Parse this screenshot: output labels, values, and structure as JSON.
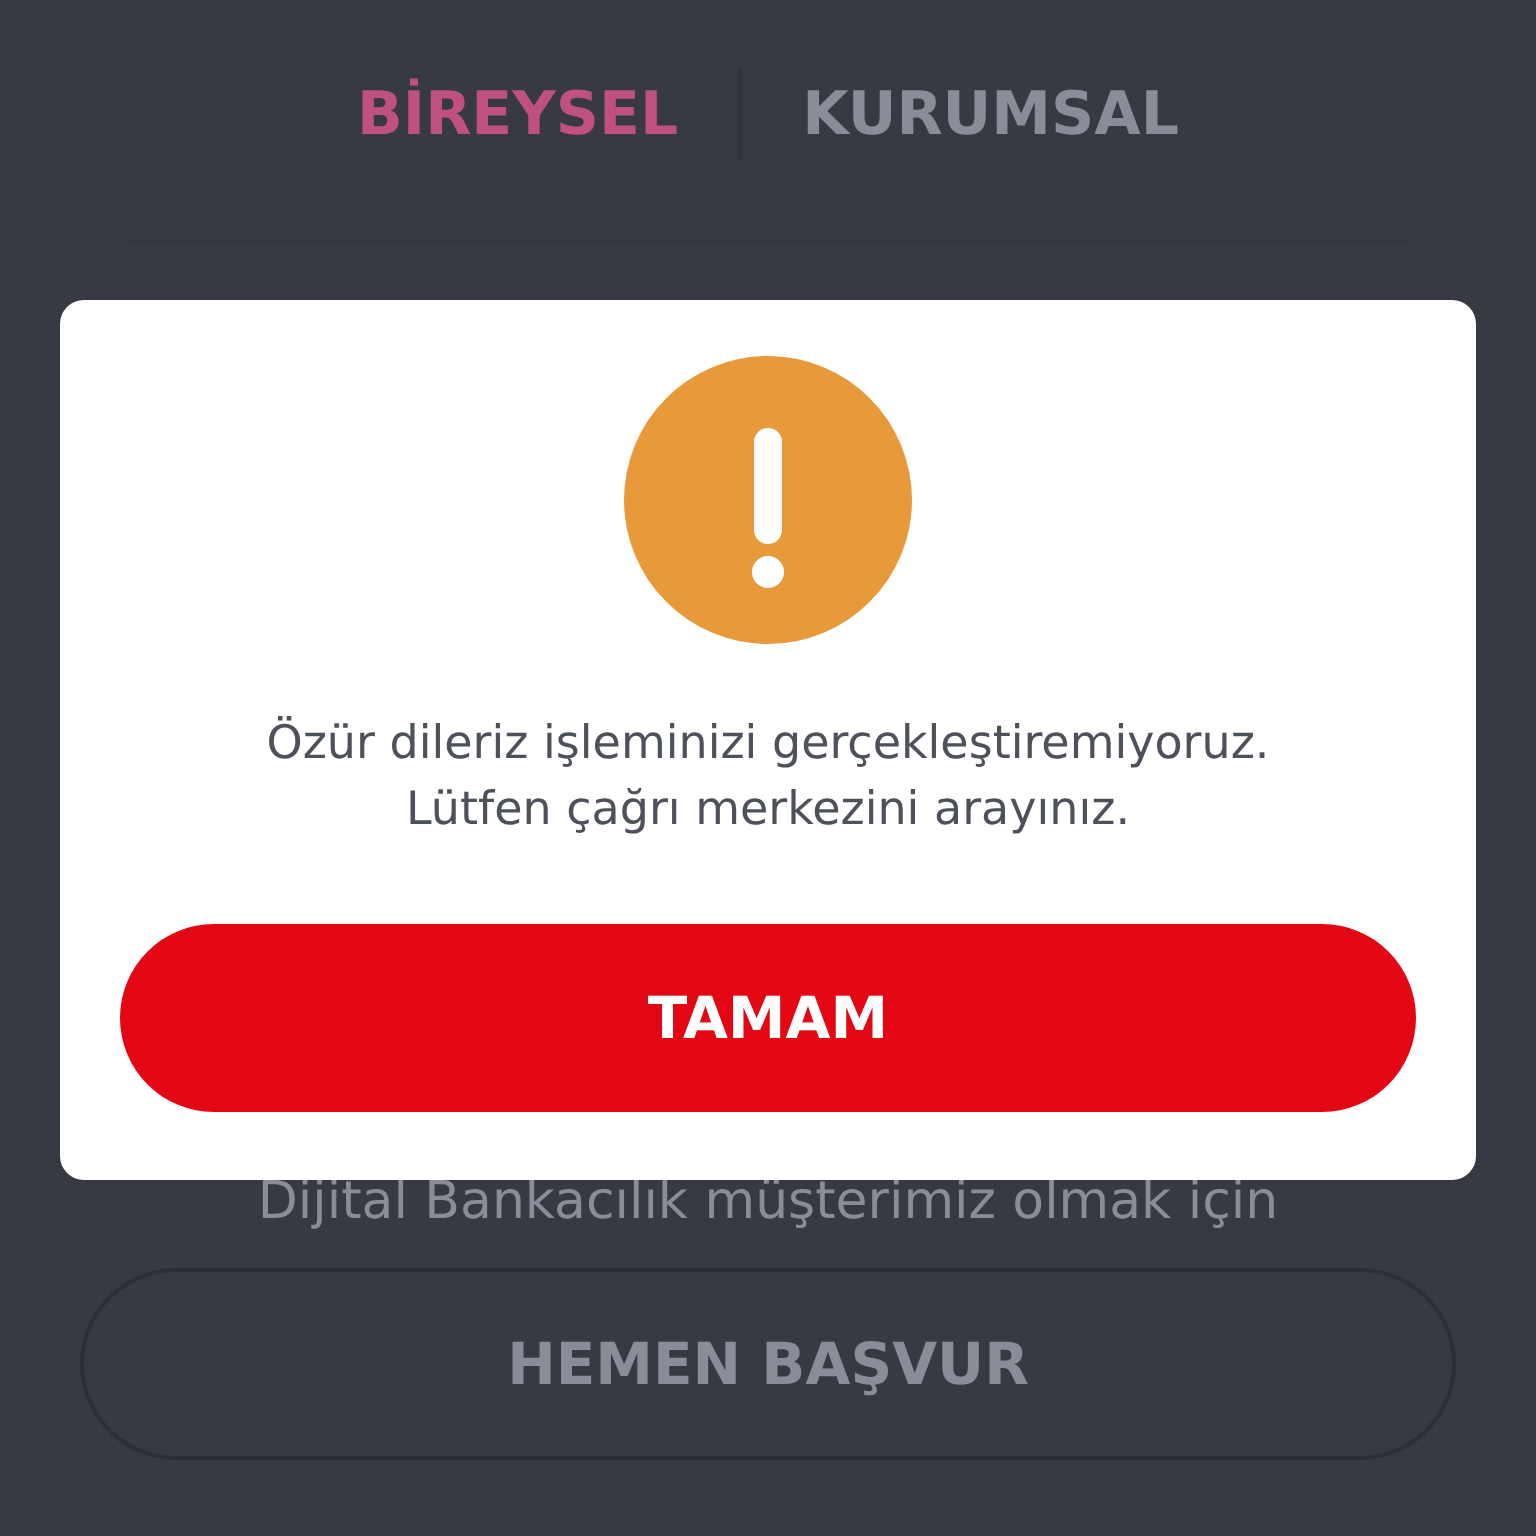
{
  "segment_tabs": [
    {
      "label": "BİREYSEL",
      "selected": true
    },
    {
      "label": "KURUMSAL",
      "selected": false
    }
  ],
  "promo": {
    "text": "Dijital Bankacılık müşterimiz olmak için",
    "button": "HEMEN BAŞVUR"
  },
  "dialog": {
    "kind": "warning",
    "message": "Özür dileriz işleminizi gerçekleştiremiyoruz.\nLütfen çağrı merkezini arayınız.",
    "button": "TAMAM"
  }
}
